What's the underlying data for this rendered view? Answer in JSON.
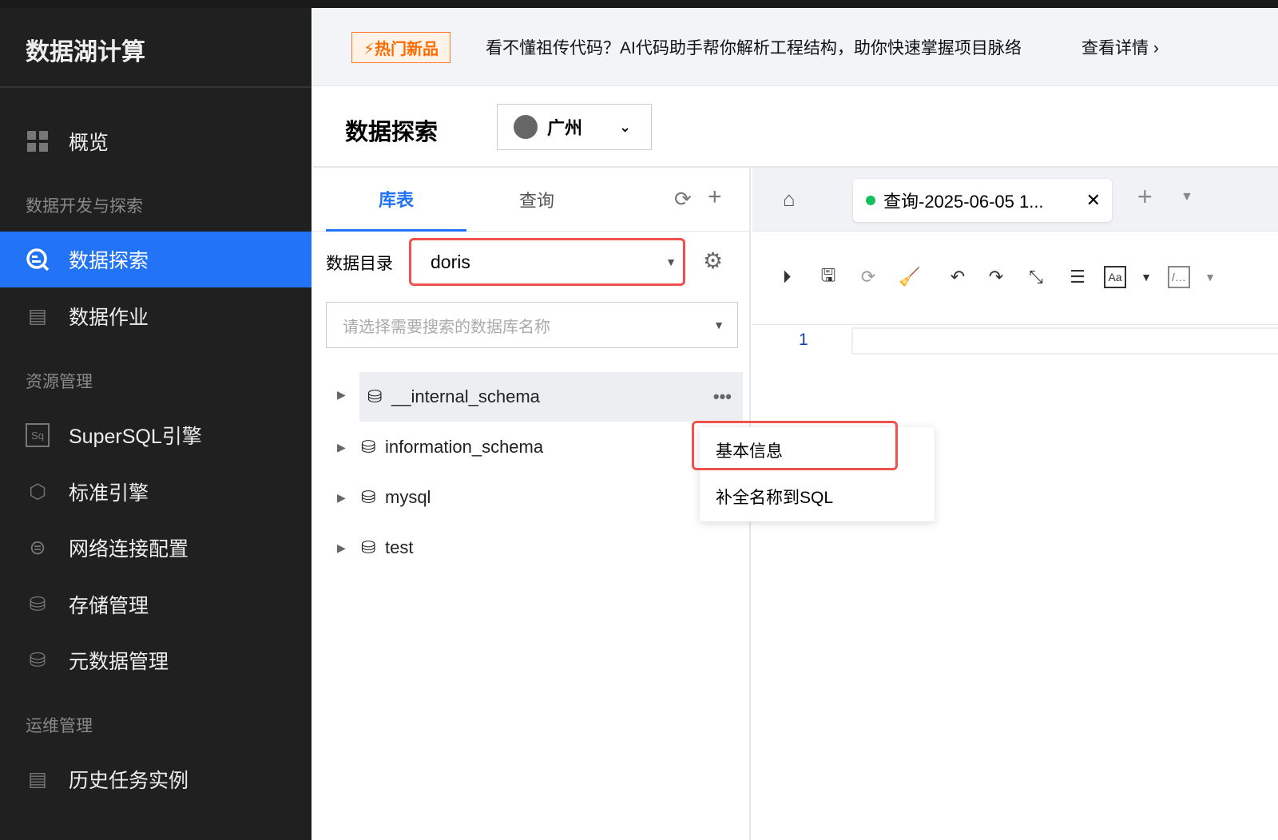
{
  "sidebar": {
    "brand": "数据湖计算",
    "items": [
      {
        "label": "概览",
        "icon": "grid-icon"
      },
      {
        "group": "数据开发与探索"
      },
      {
        "label": "数据探索",
        "icon": "search-data-icon",
        "active": true
      },
      {
        "label": "数据作业",
        "icon": "document-icon"
      },
      {
        "group": "资源管理"
      },
      {
        "label": "SuperSQL引擎",
        "icon": "sql-icon"
      },
      {
        "label": "标准引擎",
        "icon": "cube-icon"
      },
      {
        "label": "网络连接配置",
        "icon": "network-icon"
      },
      {
        "label": "存储管理",
        "icon": "storage-icon"
      },
      {
        "label": "元数据管理",
        "icon": "metadata-icon"
      },
      {
        "group": "运维管理"
      },
      {
        "label": "历史任务实例",
        "icon": "history-icon"
      }
    ]
  },
  "banner": {
    "badge": "⚡热门新品",
    "text": "看不懂祖传代码？AI代码助手帮你解析工程结构，助你快速掌握项目脉络",
    "link": "查看详情"
  },
  "header": {
    "title": "数据探索",
    "region": "广州"
  },
  "left": {
    "tabs": [
      "库表",
      "查询"
    ],
    "catalog_label": "数据目录",
    "catalog_value": "doris",
    "search_placeholder": "请选择需要搜索的数据库名称",
    "databases": [
      "__internal_schema",
      "information_schema",
      "mysql",
      "test"
    ]
  },
  "editor": {
    "tab_label": "查询-2025-06-05 1...",
    "line": "1"
  },
  "context_menu": [
    "基本信息",
    "补全名称到SQL"
  ],
  "colors": {
    "accent": "#2273f5",
    "highlight": "#f0514c",
    "status": "#13c15a"
  }
}
